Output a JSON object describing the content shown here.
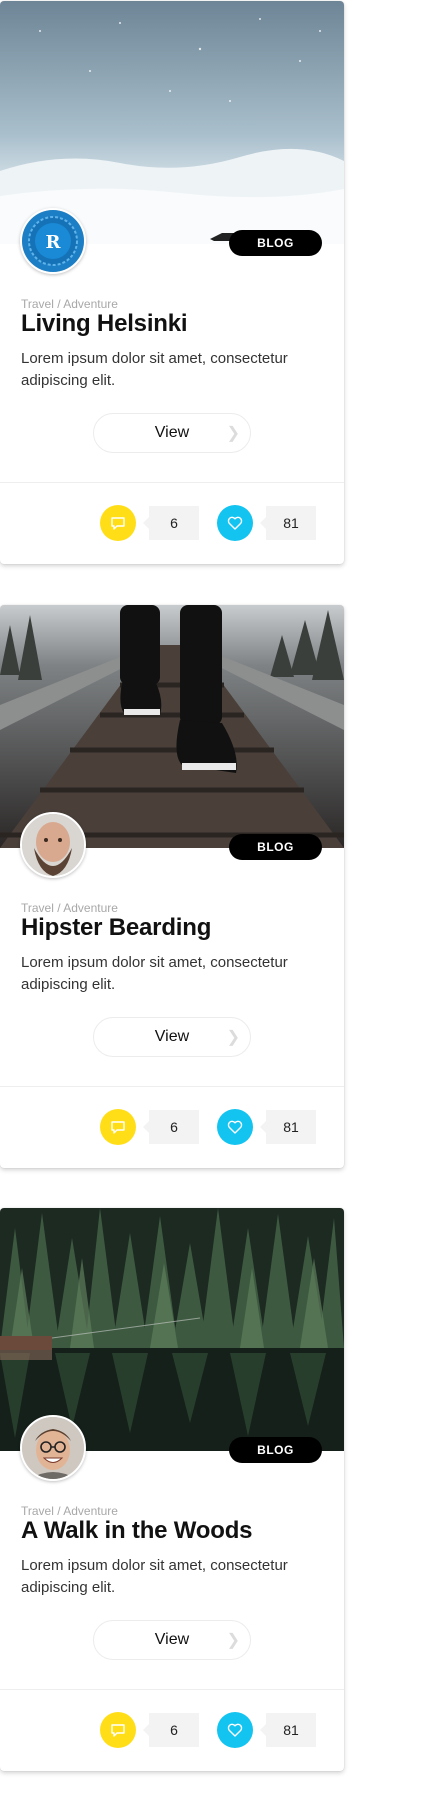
{
  "cards": [
    {
      "avatar": "logo-avatar-blue-seal",
      "badge": "BLOG",
      "category": "Travel / Adventure",
      "title": "Living Helsinki",
      "description": "Lorem ipsum dolor sit amet, consectetur adipiscing elit.",
      "view_label": "View",
      "comments": "6",
      "likes": "81"
    },
    {
      "avatar": "bearded-man-avatar",
      "badge": "BLOG",
      "category": "Travel / Adventure",
      "title": "Hipster Bearding",
      "description": "Lorem ipsum dolor sit amet, consectetur adipiscing elit.",
      "view_label": "View",
      "comments": "6",
      "likes": "81"
    },
    {
      "avatar": "smiling-man-glasses-avatar",
      "badge": "BLOG",
      "category": "Travel / Adventure",
      "title": "A Walk in the Woods",
      "description": "Lorem ipsum dolor sit amet, consectetur adipiscing elit.",
      "view_label": "View",
      "comments": "6",
      "likes": "81"
    }
  ],
  "colors": {
    "comment_accent": "#ffde17",
    "like_accent": "#13c4f0",
    "badge_bg": "#000000",
    "count_bg": "#f3f3f3"
  },
  "icons": {
    "comment": "speech-bubble-icon",
    "like": "heart-icon",
    "view_arrow": "chevron-right-icon"
  }
}
